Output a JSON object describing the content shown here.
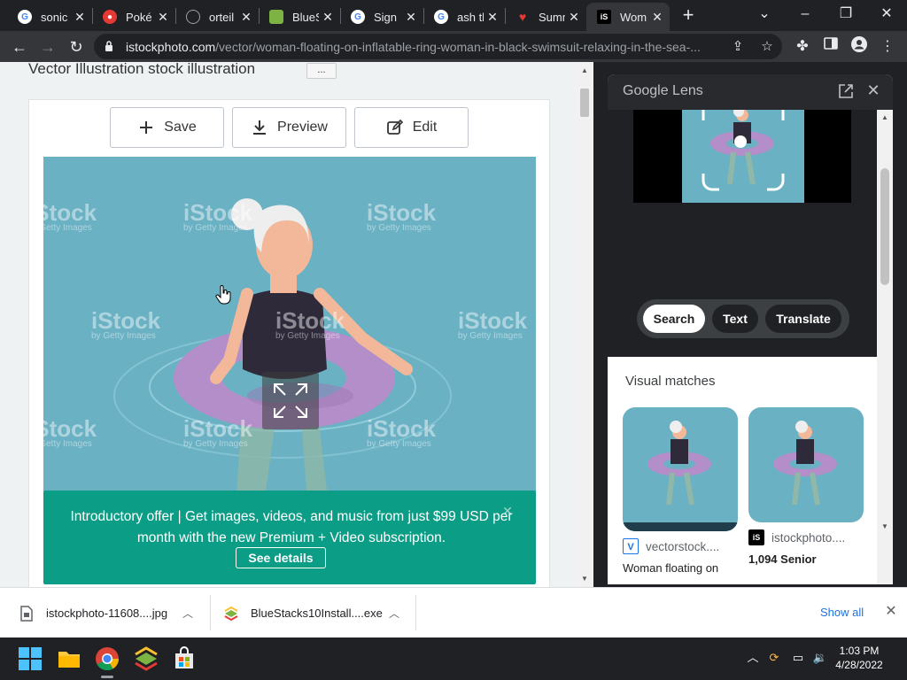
{
  "browser": {
    "tabs": [
      {
        "label": "sonic",
        "icon": "google-icon",
        "color": "#4285f4"
      },
      {
        "label": "Poké",
        "icon": "pokeball-icon",
        "color": "#e53935"
      },
      {
        "label": "orteil",
        "icon": "globe-icon",
        "color": "#9aa0a6"
      },
      {
        "label": "BlueS",
        "icon": "bluestacks-icon",
        "color": "#7cb342"
      },
      {
        "label": "Sign i",
        "icon": "google-icon",
        "color": "#4285f4"
      },
      {
        "label": "ash th",
        "icon": "google-icon",
        "color": "#4285f4"
      },
      {
        "label": "Summ",
        "icon": "heart-icon",
        "color": "#e53935"
      },
      {
        "label": "Wom",
        "icon": "istock-icon",
        "color": "#ffffff",
        "active": true
      }
    ],
    "url_domain": "istockphoto.com",
    "url_path": "/vector/woman-floating-on-inflatable-ring-woman-in-black-swimsuit-relaxing-in-the-sea-..."
  },
  "page": {
    "heading": "Vector Illustration stock illustration",
    "more_label": "...",
    "buttons": {
      "save": "Save",
      "preview": "Preview",
      "edit": "Edit"
    },
    "watermark": "iStock",
    "watermark_sub": "by Getty Images",
    "promo": {
      "text": "Introductory offer | Get images, videos, and music from just $99 USD per month with the new Premium + Video subscription.",
      "button": "See details"
    },
    "colors": {
      "image_bg": "#6ab1c4",
      "promo_bg": "#0c9d86"
    }
  },
  "lens": {
    "title": "Google Lens",
    "modes": [
      "Search",
      "Text",
      "Translate"
    ],
    "active_mode": "Search",
    "visual_matches_title": "Visual matches",
    "matches": [
      {
        "source": "vectorstock....",
        "desc": "Woman floating on"
      },
      {
        "source": "istockphoto....",
        "desc": "1,094 Senior"
      }
    ]
  },
  "downloads": {
    "items": [
      {
        "name": "istockphoto-11608....jpg"
      },
      {
        "name": "BlueStacks10Install....exe"
      }
    ],
    "show_all": "Show all"
  },
  "taskbar": {
    "time": "1:03 PM",
    "date": "4/28/2022"
  }
}
